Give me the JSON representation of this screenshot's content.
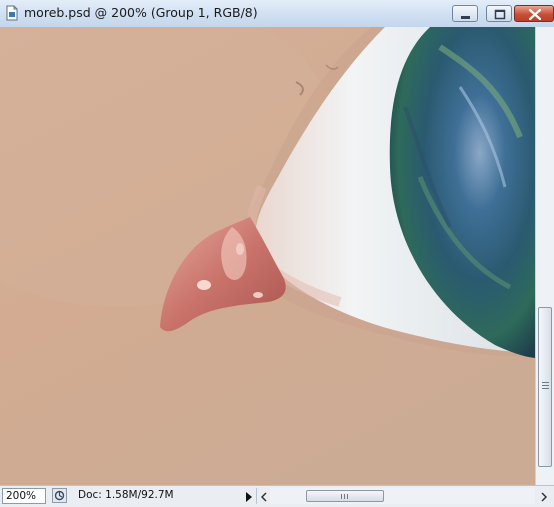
{
  "window": {
    "title": "moreb.psd @ 200% (Group 1, RGB/8)",
    "icon": "photoshop-document-icon",
    "controls": [
      "minimize-icon",
      "maximize-icon",
      "close-icon"
    ]
  },
  "canvas": {
    "subject": "close-up painting of eye corner",
    "colors": {
      "skin": "#d3ad95",
      "sclera": "#e6ebee",
      "iris": "#2f6f82",
      "caruncle": "#c8857d"
    }
  },
  "statusbar": {
    "zoom": "200%",
    "doc_info": "Doc: 1.58M/92.7M"
  }
}
